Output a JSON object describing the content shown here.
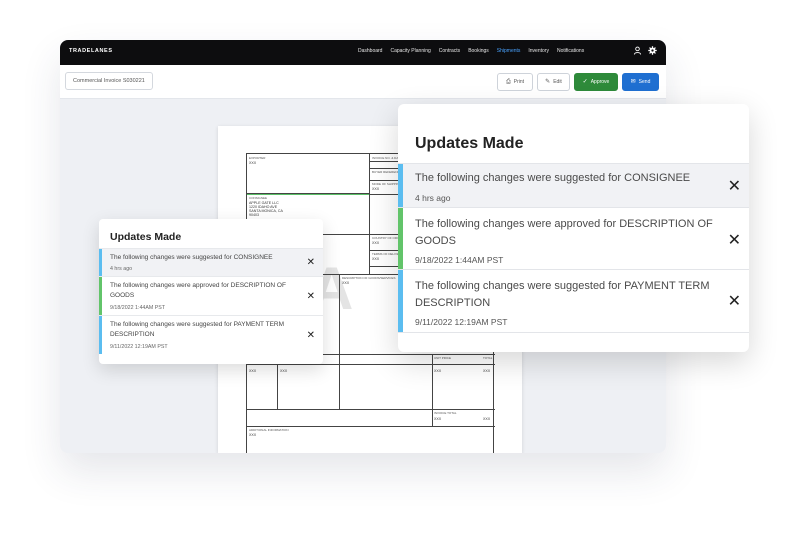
{
  "app": {
    "brand": "TRADELANES",
    "nav": [
      "Dashboard",
      "Capacity Planning",
      "Contracts",
      "Bookings",
      "Shipments",
      "Inventory",
      "Notifications"
    ],
    "active_nav": "Shipments",
    "icons": {
      "user": "user-icon",
      "settings": "gear-icon"
    }
  },
  "toolbar": {
    "document_name": "Commercial Invoice S030221",
    "print": "Print",
    "edit": "Edit",
    "approve": "Approve",
    "send": "Send"
  },
  "colors": {
    "approve": "#2e8a3a",
    "send": "#1f6fd1",
    "consignee_bar": "#5bbdf0",
    "approved_bar": "#62c46a",
    "payment_bar": "#5bbdf0",
    "active_nav": "#4aa3ff"
  },
  "document": {
    "watermark": "A",
    "fields": {
      "exporter": "EXPORTER",
      "invoice_no": "INVOICE NO. & DATE",
      "buyer_ref": "BUYER REFERENCE",
      "mode_of_shipping": "MODE OF SHIPPING",
      "consignee": "CONSIGNEE",
      "consignee_addr1": "APPLE GATE LLC",
      "consignee_addr2": "1220 IDAHO AVE",
      "consignee_addr3": "SANTA MONICA, CA",
      "consignee_addr4": "90403",
      "country_of_origin": "COUNTRY OF ORIGIN",
      "terms_of_delivery": "TERMS OF DELIVERY",
      "description": "DESCRIPTION OF GOODS/SERVICES",
      "unit_price": "UNIT PRICE",
      "total": "TOTAL",
      "invoice_total": "INVOICE TOTAL",
      "additional_info": "ADDITIONAL INFORMATION",
      "placeholder": "XXX",
      "placeholder_long": "XXXX"
    }
  },
  "updates": {
    "title": "Updates Made",
    "items": [
      {
        "message": "The following changes were suggested for CONSIGNEE",
        "time": "4 hrs ago"
      },
      {
        "message": "The following changes were approved for DESCRIPTION OF GOODS",
        "time": "9/18/2022 1:44AM PST"
      },
      {
        "message": "The following changes were suggested for PAYMENT TERM DESCRIPTION",
        "time": "9/11/2022 12:19AM PST"
      }
    ]
  },
  "updates_large": {
    "title": "Updates Made",
    "items": [
      {
        "message": "The following changes were suggested for CONSIGNEE",
        "time": "4 hrs ago"
      },
      {
        "message": "The following changes were approved for DESCRIPTION OF GOODS",
        "time": "9/18/2022 1:44AM PST"
      },
      {
        "message": "The following changes were suggested for PAYMENT TERM DESCRIPTION",
        "time": "9/11/2022 12:19AM PST"
      }
    ]
  },
  "close_glyph": "✕"
}
